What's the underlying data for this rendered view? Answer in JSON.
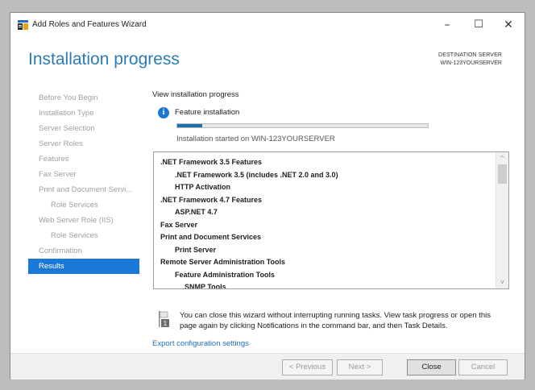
{
  "window": {
    "title": "Add Roles and Features Wizard",
    "controls": {
      "minimize": "–",
      "maximize": "☐",
      "close": "✕"
    }
  },
  "header": {
    "page_title": "Installation progress",
    "destination_label": "DESTINATION SERVER",
    "destination_server": "WIN-123YOURSERVER"
  },
  "sidebar": {
    "items": [
      {
        "label": "Before You Begin"
      },
      {
        "label": "Installation Type"
      },
      {
        "label": "Server Selection"
      },
      {
        "label": "Server Roles"
      },
      {
        "label": "Features"
      },
      {
        "label": "Fax Server"
      },
      {
        "label": "Print and Document Servi..."
      },
      {
        "label": "Role Services"
      },
      {
        "label": "Web Server Role (IIS)"
      },
      {
        "label": "Role Services"
      },
      {
        "label": "Confirmation"
      },
      {
        "label": "Results"
      }
    ],
    "active": "Results"
  },
  "main": {
    "view_progress": "View installation progress",
    "info_glyph": "i",
    "feature_installation": "Feature installation",
    "progress_fraction": 0.1,
    "install_started": "Installation started on WIN-123YOURSERVER",
    "results": [
      ".NET Framework 3.5 Features",
      ".NET Framework 3.5 (includes .NET 2.0 and 3.0)",
      "HTTP Activation",
      ".NET Framework 4.7 Features",
      "ASP.NET 4.7",
      "Fax Server",
      "Print and Document Services",
      "Print Server",
      "Remote Server Administration Tools",
      "Feature Administration Tools",
      "SNMP Tools"
    ],
    "scroll_up": "^",
    "scroll_down": "v",
    "note_badge": "1",
    "note": "You can close this wizard without interrupting running tasks. View task progress or open this page again by clicking Notifications in the command bar, and then Task Details.",
    "export_link": "Export configuration settings"
  },
  "footer": {
    "previous": "< Previous",
    "next": "Next >",
    "close": "Close",
    "cancel": "Cancel"
  },
  "colors": {
    "accent": "#1c78d6",
    "title_blue": "#2b7bb9",
    "progress": "#1b6fab",
    "link": "#1c6fc1"
  }
}
